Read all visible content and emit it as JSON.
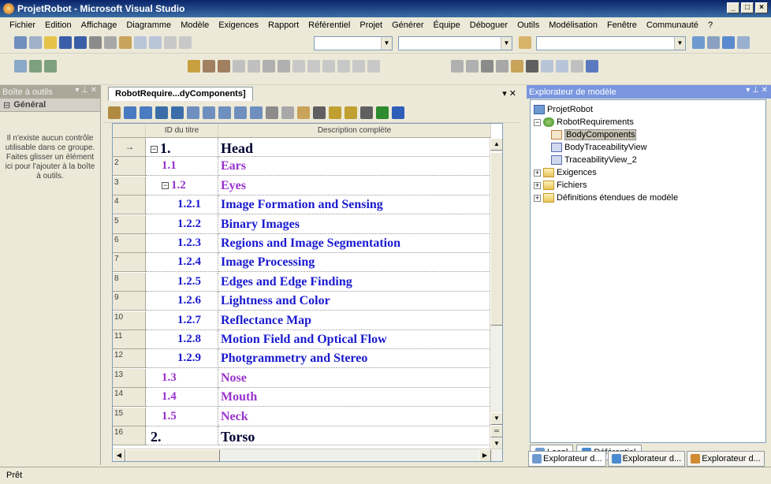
{
  "window": {
    "title": "ProjetRobot - Microsoft Visual Studio",
    "controls": [
      "_",
      "□",
      "×"
    ]
  },
  "menu": [
    "Fichier",
    "Edition",
    "Affichage",
    "Diagramme",
    "Modèle",
    "Exigences",
    "Rapport",
    "Référentiel",
    "Projet",
    "Générer",
    "Équipe",
    "Déboguer",
    "Outils",
    "Modélisation",
    "Fenêtre",
    "Communauté",
    "?"
  ],
  "toolbox": {
    "header": "Boîte à outils",
    "group": "Général",
    "message": "Il n'existe aucun contrôle utilisable dans ce groupe. Faites glisser un élément ici pour l'ajouter à la boîte à outils."
  },
  "editor": {
    "tab": "RobotRequire...dyComponents]",
    "columns": {
      "id": "ID du titre",
      "desc": "Description complète"
    },
    "rows": [
      {
        "num": "→",
        "id": "1.",
        "desc": "Head",
        "level": 1,
        "expander": "⊟"
      },
      {
        "num": "2",
        "id": "1.1",
        "desc": "Ears",
        "level": 2
      },
      {
        "num": "3",
        "id": "1.2",
        "desc": "Eyes",
        "level": 2,
        "expander": "⊟"
      },
      {
        "num": "4",
        "id": "1.2.1",
        "desc": "Image Formation and Sensing",
        "level": 3
      },
      {
        "num": "5",
        "id": "1.2.2",
        "desc": "Binary Images",
        "level": 3
      },
      {
        "num": "6",
        "id": "1.2.3",
        "desc": "Regions and Image Segmentation",
        "level": 3
      },
      {
        "num": "7",
        "id": "1.2.4",
        "desc": "Image Processing",
        "level": 3
      },
      {
        "num": "8",
        "id": "1.2.5",
        "desc": "Edges and Edge Finding",
        "level": 3
      },
      {
        "num": "9",
        "id": "1.2.6",
        "desc": "Lightness and Color",
        "level": 3
      },
      {
        "num": "10",
        "id": "1.2.7",
        "desc": "Reflectance Map",
        "level": 3
      },
      {
        "num": "11",
        "id": "1.2.8",
        "desc": "Motion Field and Optical Flow",
        "level": 3
      },
      {
        "num": "12",
        "id": "1.2.9",
        "desc": "Photgrammetry and Stereo",
        "level": 3
      },
      {
        "num": "13",
        "id": "1.3",
        "desc": "Nose",
        "level": 2
      },
      {
        "num": "14",
        "id": "1.4",
        "desc": "Mouth",
        "level": 2
      },
      {
        "num": "15",
        "id": "1.5",
        "desc": "Neck",
        "level": 2
      },
      {
        "num": "16",
        "id": "2.",
        "desc": "Torso",
        "level": 1
      }
    ]
  },
  "explorer": {
    "header": "Explorateur de modèle",
    "tree": [
      {
        "label": "ProjetRobot",
        "depth": 0,
        "icon": "project-icon"
      },
      {
        "label": "RobotRequirements",
        "depth": 1,
        "icon": "model-icon",
        "toggle": "⊟"
      },
      {
        "label": "BodyComponents",
        "depth": 2,
        "icon": "view-icon",
        "selected": true
      },
      {
        "label": "BodyTraceabilityView",
        "depth": 2,
        "icon": "trace-view-icon"
      },
      {
        "label": "TraceabilityView_2",
        "depth": 2,
        "icon": "trace-view-icon"
      },
      {
        "label": "Exigences",
        "depth": 1,
        "icon": "folder-icon",
        "toggle": "⊞"
      },
      {
        "label": "Fichiers",
        "depth": 1,
        "icon": "folder-icon",
        "toggle": "⊞"
      },
      {
        "label": "Définitions étendues de modèle",
        "depth": 1,
        "icon": "folder-icon",
        "toggle": "⊞"
      }
    ],
    "subtabs": [
      "Local",
      "Référentiel"
    ]
  },
  "bottom_tabs": [
    "Explorateur d...",
    "Explorateur d...",
    "Explorateur d..."
  ],
  "status": "Prêt"
}
